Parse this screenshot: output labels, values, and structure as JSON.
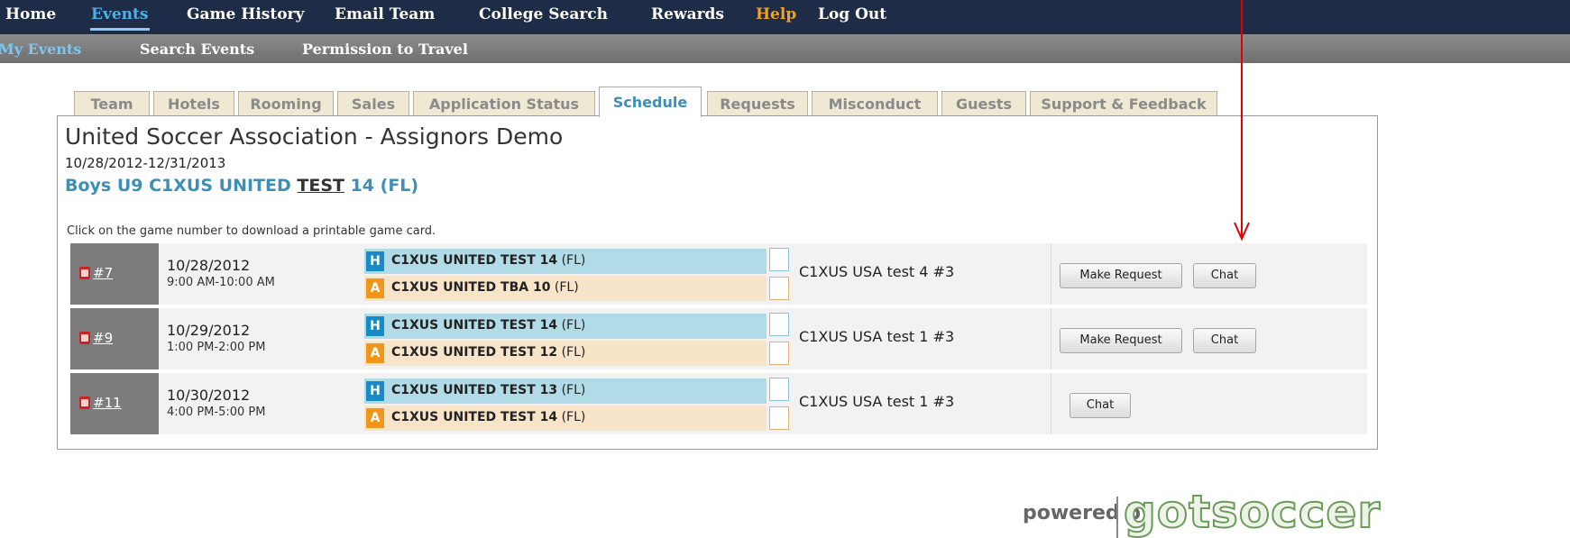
{
  "top_nav": {
    "items": [
      {
        "label": "Home"
      },
      {
        "label": "Events",
        "active": true
      },
      {
        "label": "Game History"
      },
      {
        "label": "Email Team"
      },
      {
        "label": "College Search"
      },
      {
        "label": "Rewards"
      },
      {
        "label": "Help"
      },
      {
        "label": "Log Out"
      }
    ]
  },
  "sub_nav": {
    "items": [
      {
        "label": "My Events",
        "active": true
      },
      {
        "label": "Search Events"
      },
      {
        "label": "Permission to Travel"
      }
    ]
  },
  "tabs": [
    {
      "label": "Team"
    },
    {
      "label": "Hotels"
    },
    {
      "label": "Rooming"
    },
    {
      "label": "Sales"
    },
    {
      "label": "Application Status"
    },
    {
      "label": "Schedule",
      "active": true
    },
    {
      "label": "Requests"
    },
    {
      "label": "Misconduct"
    },
    {
      "label": "Guests"
    },
    {
      "label": "Support & Feedback"
    }
  ],
  "event": {
    "title": "United Soccer Association - Assignors Demo",
    "dates": "10/28/2012-12/31/2013",
    "team_prefix": "Boys U9 C1XUS UNITED ",
    "team_underlined": "TEST",
    "team_suffix": " 14 (FL)"
  },
  "instructions": "Click on the game number to download a printable game card.",
  "games": [
    {
      "number": "#7",
      "date": "10/28/2012",
      "time": "9:00 AM-10:00 AM",
      "home_badge": "H",
      "home_team": "C1XUS UNITED TEST 14",
      "home_state": "(FL)",
      "away_badge": "A",
      "away_team": "C1XUS UNITED TBA 10",
      "away_state": "(FL)",
      "field": "C1XUS USA test 4 #3",
      "make_request": "Make Request",
      "chat": "Chat"
    },
    {
      "number": "#9",
      "date": "10/29/2012",
      "time": "1:00 PM-2:00 PM",
      "home_badge": "H",
      "home_team": "C1XUS UNITED TEST 14",
      "home_state": "(FL)",
      "away_badge": "A",
      "away_team": "C1XUS UNITED TEST 12",
      "away_state": "(FL)",
      "field": "C1XUS USA test 1 #3",
      "make_request": "Make Request",
      "chat": "Chat"
    },
    {
      "number": "#11",
      "date": "10/30/2012",
      "time": "4:00 PM-5:00 PM",
      "home_badge": "H",
      "home_team": "C1XUS UNITED TEST 13",
      "home_state": "(FL)",
      "away_badge": "A",
      "away_team": "C1XUS UNITED TEST 14",
      "away_state": "(FL)",
      "field": "C1XUS USA test 1 #3",
      "chat": "Chat"
    }
  ],
  "logo": {
    "powered": "powered by",
    "brand": "gotsoccer"
  },
  "colors": {
    "nav_bg": "#1e2c47",
    "nav_active": "#4fb0e6",
    "help": "#f4a21a",
    "link_blue": "#3d8fb8",
    "home_bar": "#b2dbe8",
    "away_bar": "#f8e4c8",
    "annotation_arrow": "#e00000"
  }
}
